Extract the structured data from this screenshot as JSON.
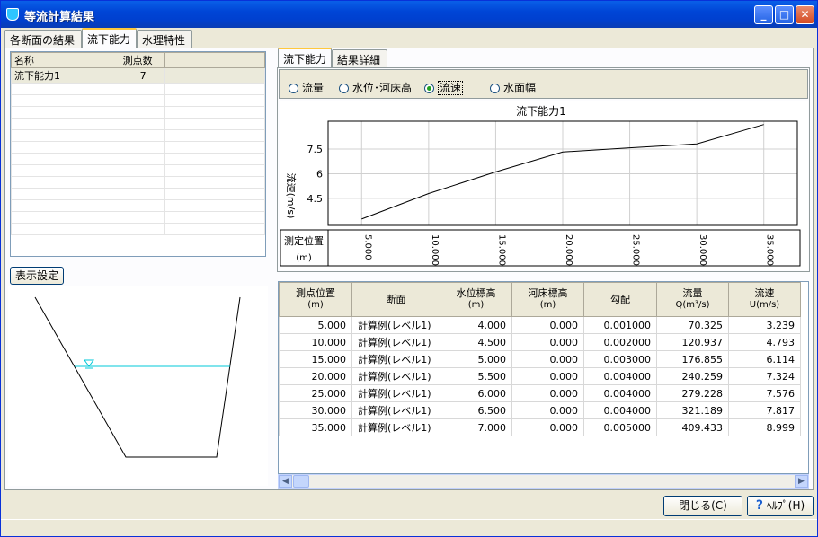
{
  "window": {
    "title": "等流計算結果",
    "icon": "water-cup-icon"
  },
  "main_tabs": [
    "各断面の結果",
    "流下能力",
    "水理特性"
  ],
  "list": {
    "headers": [
      "名称",
      "測点数"
    ],
    "rows": [
      {
        "name": "流下能力1",
        "count": "7"
      }
    ]
  },
  "display_settings_label": "表示設定",
  "right_tabs": [
    "流下能力",
    "結果詳細"
  ],
  "radios": [
    {
      "label": "流量",
      "checked": false
    },
    {
      "label": "水位･河床高",
      "checked": false
    },
    {
      "label": "流速",
      "checked": true
    },
    {
      "label": "水面幅",
      "checked": false
    }
  ],
  "chart_data": {
    "type": "line",
    "title": "流下能力1",
    "ylabel": "流速(m/s)",
    "xlabel": "測定位置 (m)",
    "x": [
      5,
      10,
      15,
      20,
      25,
      30,
      35
    ],
    "x_tick_labels": [
      "5.000",
      "10.000",
      "15.000",
      "20.000",
      "25.000",
      "30.000",
      "35.000"
    ],
    "y_ticks": [
      "4.5",
      "6",
      "7.5"
    ],
    "y_tick_values": [
      4.5,
      6,
      7.5
    ],
    "series": [
      {
        "values": [
          3.239,
          4.793,
          6.114,
          7.324,
          7.576,
          7.817,
          8.999
        ]
      }
    ],
    "xlim": [
      2.5,
      37.5
    ],
    "ylim": [
      2.85,
      9.2
    ],
    "grid": true
  },
  "results": {
    "headers": [
      {
        "l1": "測点位置",
        "l2": "(m)"
      },
      {
        "l1": "断面",
        "l2": ""
      },
      {
        "l1": "水位標高",
        "l2": "(m)"
      },
      {
        "l1": "河床標高",
        "l2": "(m)"
      },
      {
        "l1": "勾配",
        "l2": ""
      },
      {
        "l1": "流量",
        "l2": "Q(m³/s)"
      },
      {
        "l1": "流速",
        "l2": "U(m/s)"
      }
    ],
    "rows": [
      [
        "5.000",
        "計算例(レベル1)",
        "4.000",
        "0.000",
        "0.001000",
        "70.325",
        "3.239"
      ],
      [
        "10.000",
        "計算例(レベル1)",
        "4.500",
        "0.000",
        "0.002000",
        "120.937",
        "4.793"
      ],
      [
        "15.000",
        "計算例(レベル1)",
        "5.000",
        "0.000",
        "0.003000",
        "176.855",
        "6.114"
      ],
      [
        "20.000",
        "計算例(レベル1)",
        "5.500",
        "0.000",
        "0.004000",
        "240.259",
        "7.324"
      ],
      [
        "25.000",
        "計算例(レベル1)",
        "6.000",
        "0.000",
        "0.004000",
        "279.228",
        "7.576"
      ],
      [
        "30.000",
        "計算例(レベル1)",
        "6.500",
        "0.000",
        "0.004000",
        "321.189",
        "7.817"
      ],
      [
        "35.000",
        "計算例(レベル1)",
        "7.000",
        "0.000",
        "0.005000",
        "409.433",
        "8.999"
      ]
    ]
  },
  "buttons": {
    "close": "閉じる(C)",
    "help": "ﾍﾙﾌﾟ(H)"
  },
  "colors": {
    "water_line": "#00c8d8",
    "title_bar": "#0a5fe8"
  }
}
